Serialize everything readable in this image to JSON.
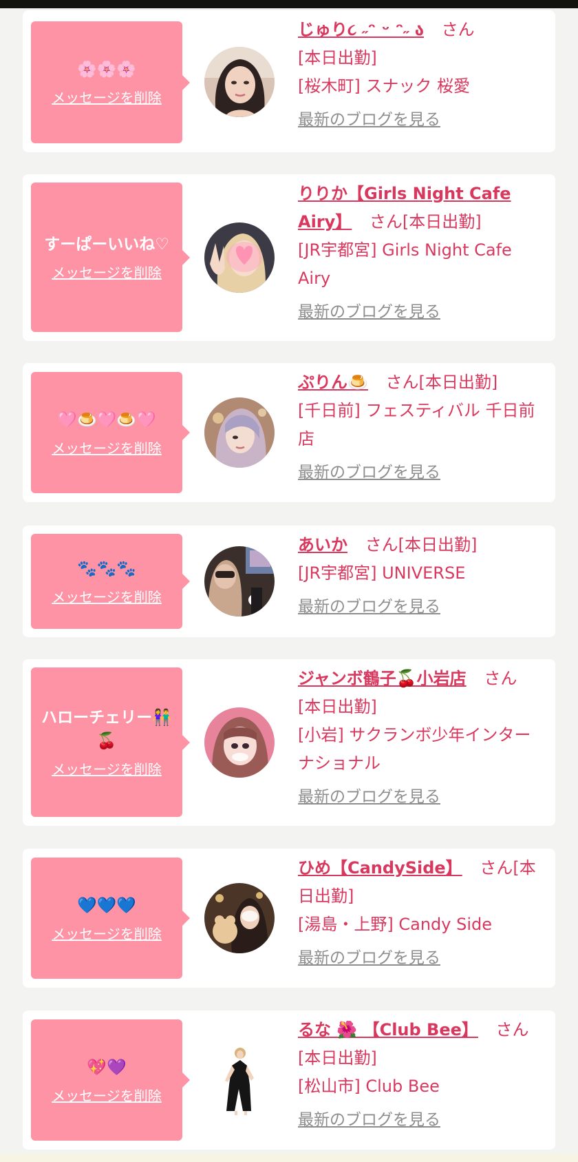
{
  "cards": [
    {
      "message": "🌸🌸🌸",
      "delete_label": "メッセージを削除",
      "name": "じゅり૮ ˶ᵔ ᵕ ᵔ˶ ა",
      "suffix": "さん",
      "status": "[本日出勤]",
      "area_shop": "[桜木町] スナック 桜愛",
      "blog_label": "最新のブログを見る"
    },
    {
      "message": "すーぱーいいね♡",
      "delete_label": "メッセージを削除",
      "name": "りりか【Girls Night Cafe Airy】",
      "suffix": "さん",
      "status": "[本日出勤]",
      "area_shop": "[JR宇都宮] Girls Night Cafe Airy",
      "blog_label": "最新のブログを見る"
    },
    {
      "message": "🩷🍮🩷🍮🩷",
      "delete_label": "メッセージを削除",
      "name": "ぷりん🍮",
      "suffix": "さん",
      "status": "[本日出勤]",
      "area_shop": "[千日前] フェスティバル 千日前店",
      "blog_label": "最新のブログを見る"
    },
    {
      "message": "🐾🐾🐾",
      "delete_label": "メッセージを削除",
      "name": "あいか",
      "suffix": "さん",
      "status": "[本日出勤]",
      "area_shop": "[JR宇都宮] UNIVERSE",
      "blog_label": "最新のブログを見る"
    },
    {
      "message": "ハローチェリー👫🍒",
      "delete_label": "メッセージを削除",
      "name": "ジャンボ鶴子🍒小岩店",
      "suffix": "さん",
      "status": "[本日出勤]",
      "area_shop": "[小岩] サクランボ少年インターナショナル",
      "blog_label": "最新のブログを見る"
    },
    {
      "message": "💙💙💙",
      "delete_label": "メッセージを削除",
      "name": "ひめ【CandySide】",
      "suffix": "さん",
      "status": "[本日出勤]",
      "area_shop": "[湯島・上野] Candy Side",
      "blog_label": "最新のブログを見る"
    },
    {
      "message": "💖💜",
      "delete_label": "メッセージを削除",
      "name": "るな 🌺 【Club Bee】",
      "suffix": "さん",
      "status": "[本日出勤]",
      "area_shop": "[松山市] Club Bee",
      "blog_label": "最新のブログを見る"
    }
  ],
  "colors": {
    "accent": "#d9385e",
    "bubble": "#fd93a5",
    "link_gray": "#8d8d8d",
    "background": "#f3f3f1"
  }
}
